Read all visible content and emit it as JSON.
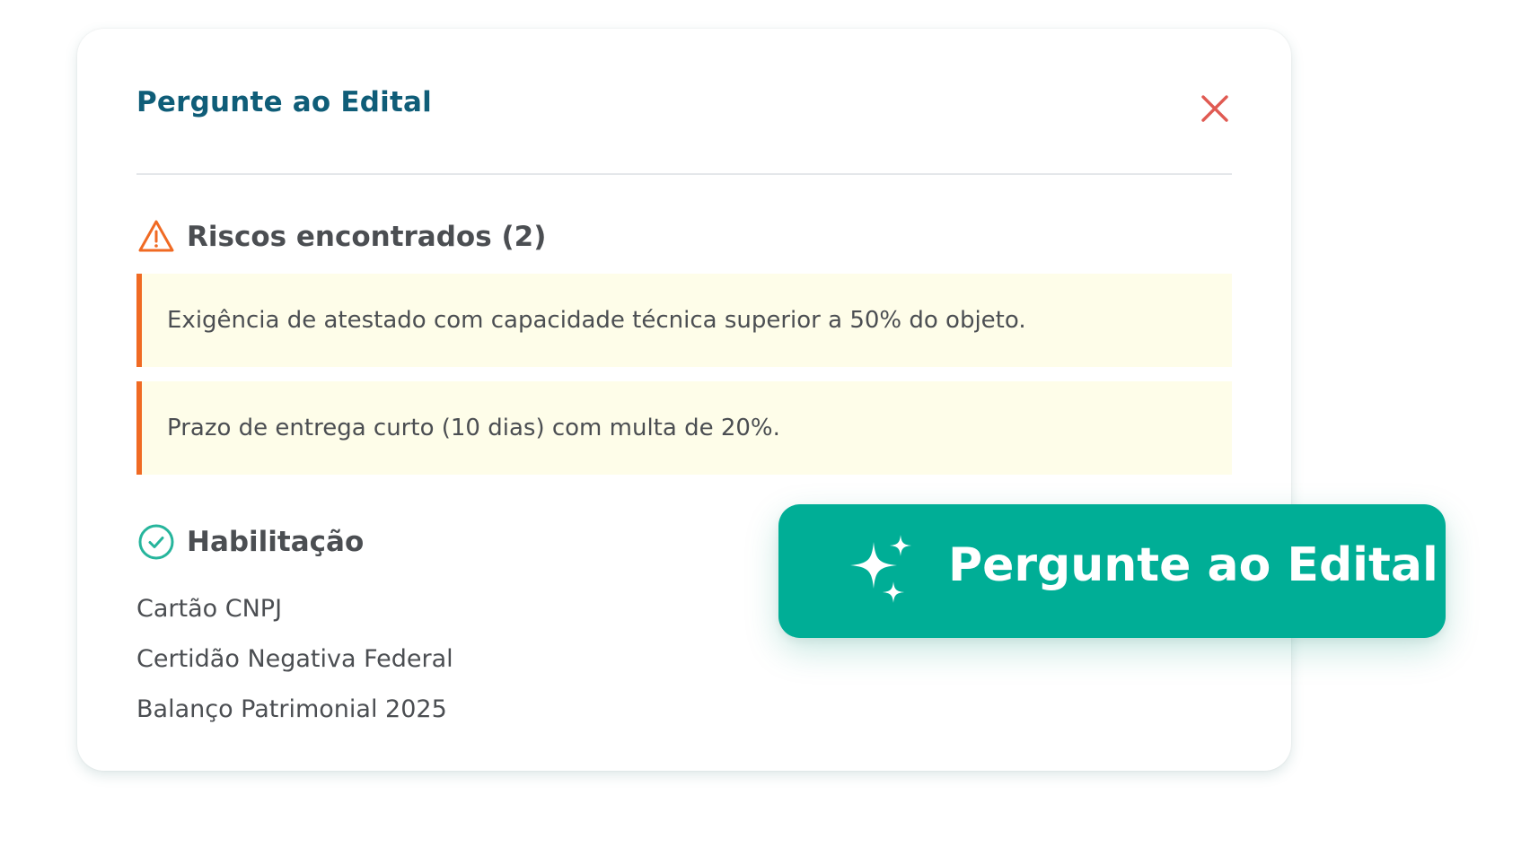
{
  "modal": {
    "title": "Pergunte ao Edital",
    "close_icon": "close-icon"
  },
  "risks": {
    "title": "Riscos encontrados (2)",
    "icon": "warning-triangle-icon",
    "items": [
      {
        "text": "Exigência de atestado com capacidade técnica superior a 50% do objeto."
      },
      {
        "text": "Prazo de entrega curto (10 dias) com multa de 20%."
      }
    ]
  },
  "habilitacao": {
    "title": "Habilitação",
    "icon": "check-circle-icon",
    "items": [
      {
        "text": "Cartão CNPJ"
      },
      {
        "text": "Certidão Negativa Federal"
      },
      {
        "text": "Balanço Patrimonial 2025"
      }
    ]
  },
  "cta": {
    "label": "Pergunte ao Edital",
    "icon": "sparkles-icon"
  },
  "colors": {
    "title": "#0f5d78",
    "close": "#e05a52",
    "warning": "#f06a23",
    "risk_bg": "#fefde9",
    "check": "#26b59c",
    "cta_bg": "#00ae96"
  }
}
